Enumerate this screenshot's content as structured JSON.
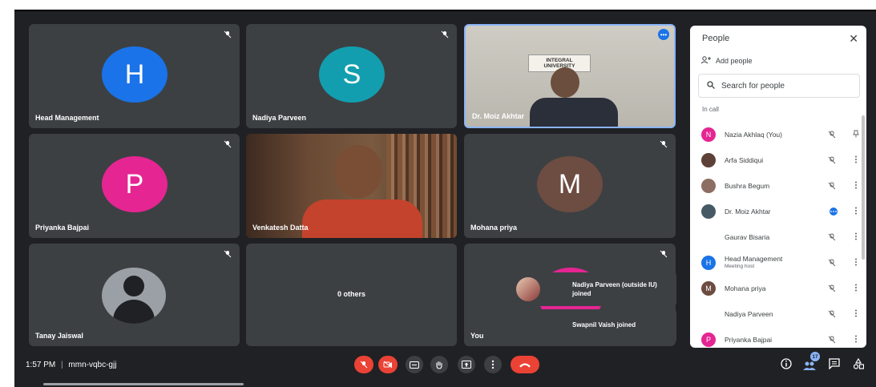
{
  "tiles": [
    {
      "name": "Head Management",
      "letter": "H",
      "color": "#1a73e8"
    },
    {
      "name": "Nadiya Parveen",
      "letter": "S",
      "color": "#129eaf"
    },
    {
      "name": "Dr. Moiz Akhtar",
      "sign_text": "INTEGRAL UNIVERSITY"
    },
    {
      "name": "Priyanka Bajpai",
      "letter": "P",
      "color": "#e52592"
    },
    {
      "name": "Venkatesh Datta"
    },
    {
      "name": "Mohana priya",
      "letter": "M",
      "color": "#6d4c41"
    },
    {
      "name": "Tanay Jaiswal"
    },
    {
      "name": "0 others"
    },
    {
      "name": "You"
    }
  ],
  "toasts": [
    {
      "text": "Nadiya Parveen (outside IU) joined"
    },
    {
      "text": "Swapnil Vaish joined"
    }
  ],
  "people_panel": {
    "title": "People",
    "add_people": "Add people",
    "search_placeholder": "Search for people",
    "in_call_label": "In call",
    "participants": [
      {
        "name": "Nazia Akhlaq (You)",
        "initial": "N",
        "color": "#e52592",
        "action_icon": "pin-icon"
      },
      {
        "name": "Arfa Siddiqui",
        "initial": "",
        "color": "#5d4037",
        "action_icon": "more-icon"
      },
      {
        "name": "Bushra Begum",
        "initial": "",
        "color": "#8d6e63",
        "action_icon": "more-icon"
      },
      {
        "name": "Dr. Moiz Akhtar",
        "initial": "",
        "color": "#455a64",
        "action_icon": "more-icon"
      },
      {
        "name": "Gaurav Bisaria",
        "initial": "",
        "color": "",
        "action_icon": "more-icon"
      },
      {
        "name": "Head Management",
        "sub": "Meeting host",
        "initial": "H",
        "color": "#1a73e8",
        "action_icon": "more-icon"
      },
      {
        "name": "Mohana priya",
        "initial": "M",
        "color": "#6d4c41",
        "action_icon": "more-icon"
      },
      {
        "name": "Nadiya Parveen",
        "initial": "",
        "color": "",
        "action_icon": "more-icon"
      },
      {
        "name": "Priyanka Bajpai",
        "initial": "P",
        "color": "#e52592",
        "action_icon": "more-icon"
      }
    ]
  },
  "bottom_bar": {
    "time": "1:57 PM",
    "separator": "|",
    "meeting_code": "mmn-vqbc-gjj",
    "people_count": "17",
    "colors": {
      "danger": "#ea4335",
      "control": "#3c4043"
    }
  }
}
